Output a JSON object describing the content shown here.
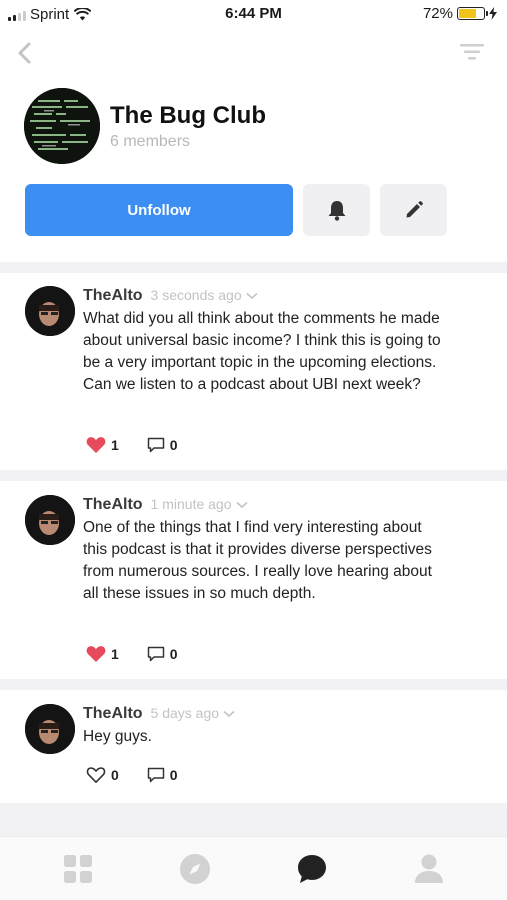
{
  "status_bar": {
    "carrier": "Sprint",
    "time": "6:44 PM",
    "battery_percent": "72%",
    "battery_level": 0.72,
    "battery_color": "#f0c419"
  },
  "nav": {
    "back_icon": "chevron-left-icon",
    "filter_icon": "filter-icon"
  },
  "club": {
    "name": "The Bug Club",
    "members": "6 members"
  },
  "actions": {
    "unfollow_label": "Unfollow",
    "notifications_icon": "bell-icon",
    "edit_icon": "pencil-icon",
    "accent_color": "#3d8ef2"
  },
  "posts": [
    {
      "author": "TheAlto",
      "time": "3 seconds ago",
      "text": "What did you all think about the comments he made about universal basic income? I think this is going to be a very important topic in the upcoming elections. Can we listen to a podcast about UBI next week?",
      "likes": "1",
      "liked": true,
      "comments": "0"
    },
    {
      "author": "TheAlto",
      "time": "1 minute ago",
      "text": "One of the things that I find very interesting about this podcast is that it provides diverse perspectives from numerous sources. I really love hearing about all these issues in so much depth.",
      "likes": "1",
      "liked": true,
      "comments": "0"
    },
    {
      "author": "TheAlto",
      "time": "5 days ago",
      "text": "Hey guys.",
      "likes": "0",
      "liked": false,
      "comments": "0"
    }
  ],
  "tab_bar": {
    "tabs": [
      "grid-icon",
      "compass-icon",
      "chat-bubble-icon",
      "profile-icon"
    ],
    "active_tab": "chat-bubble-icon"
  }
}
